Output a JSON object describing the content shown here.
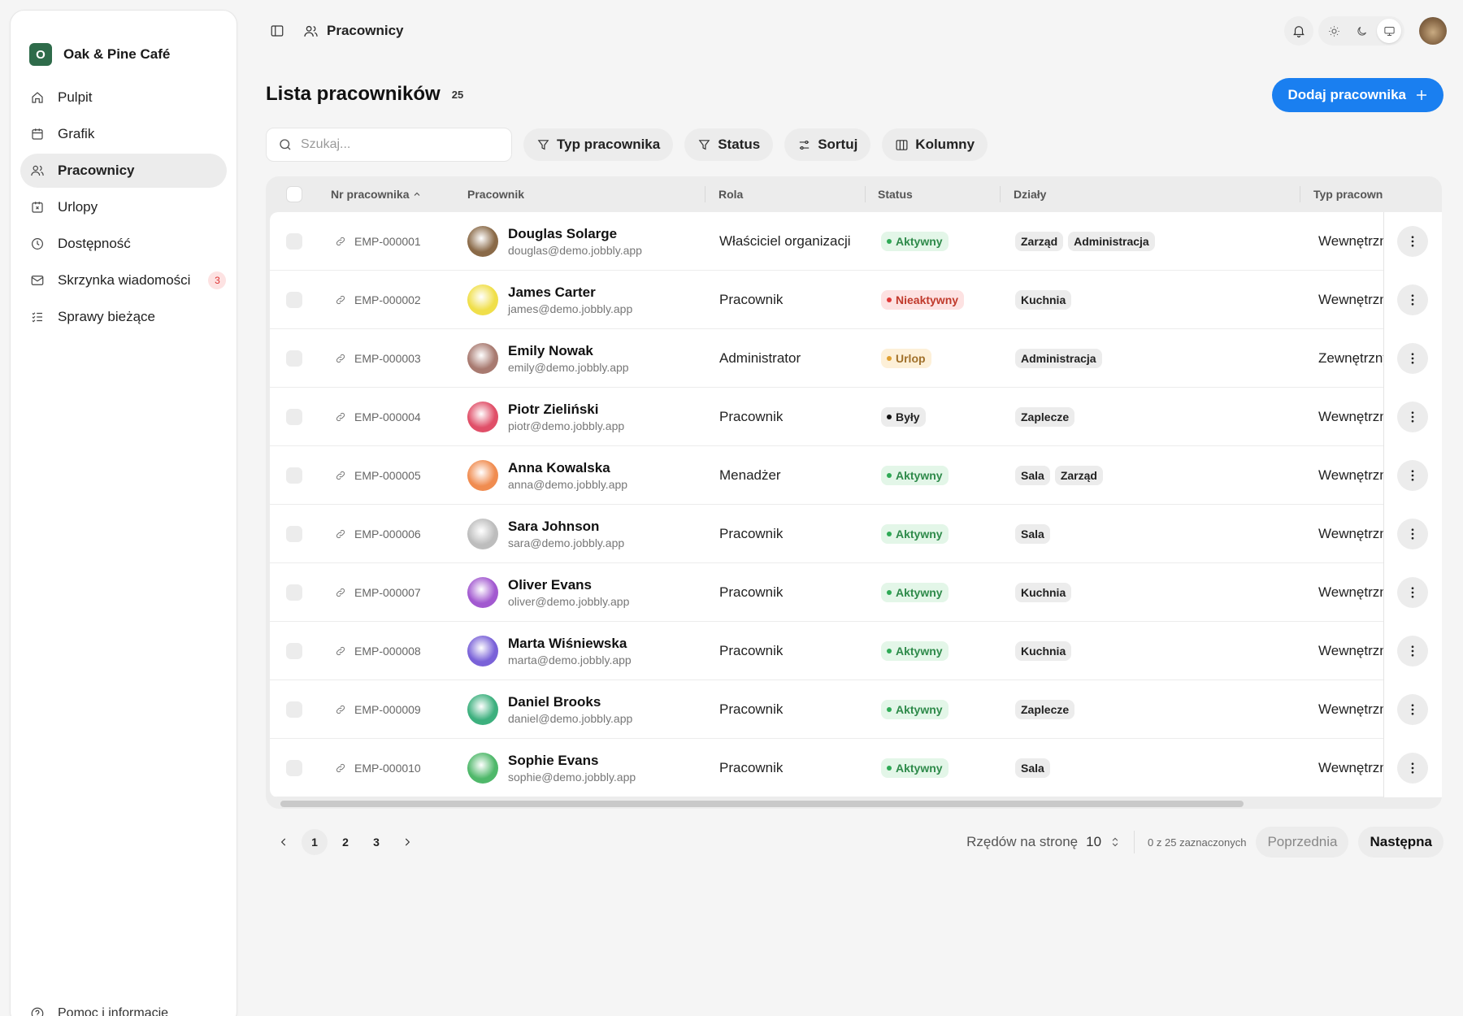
{
  "sidebar": {
    "brand_initial": "O",
    "brand_name": "Oak & Pine Café",
    "items": [
      {
        "label": "Pulpit",
        "icon": "home-icon",
        "badge": ""
      },
      {
        "label": "Grafik",
        "icon": "calendar-icon",
        "badge": ""
      },
      {
        "label": "Pracownicy",
        "icon": "users-icon",
        "badge": "",
        "active": true
      },
      {
        "label": "Urlopy",
        "icon": "calendar-x-icon",
        "badge": ""
      },
      {
        "label": "Dostępność",
        "icon": "clock-icon",
        "badge": ""
      },
      {
        "label": "Skrzynka wiadomości",
        "icon": "mail-icon",
        "badge": "3"
      },
      {
        "label": "Sprawy bieżące",
        "icon": "list-check-icon",
        "badge": ""
      }
    ],
    "help_label": "Pomoc i informacje"
  },
  "topbar": {
    "breadcrumb": "Pracownicy"
  },
  "page": {
    "title": "Lista pracowników",
    "count": "25",
    "add_button": "Dodaj pracownika"
  },
  "toolbar": {
    "search_placeholder": "Szukaj...",
    "filter_type": "Typ pracownika",
    "filter_status": "Status",
    "sort": "Sortuj",
    "columns": "Kolumny"
  },
  "table": {
    "headers": {
      "id": "Nr pracownika",
      "employee": "Pracownik",
      "role": "Rola",
      "status": "Status",
      "departments": "Działy",
      "type": "Typ pracown"
    },
    "rows": [
      {
        "id": "EMP-000001",
        "name": "Douglas Solarge",
        "email": "douglas@demo.jobbly.app",
        "role": "Właściciel organizacji",
        "status": "Aktywny",
        "depts": [
          "Zarząd",
          "Administracja"
        ],
        "type": "Wewnętrzny"
      },
      {
        "id": "EMP-000002",
        "name": "James Carter",
        "email": "james@demo.jobbly.app",
        "role": "Pracownik",
        "status": "Nieaktywny",
        "depts": [
          "Kuchnia"
        ],
        "type": "Wewnętrzny"
      },
      {
        "id": "EMP-000003",
        "name": "Emily Nowak",
        "email": "emily@demo.jobbly.app",
        "role": "Administrator",
        "status": "Urlop",
        "depts": [
          "Administracja"
        ],
        "type": "Zewnętrzny"
      },
      {
        "id": "EMP-000004",
        "name": "Piotr Zieliński",
        "email": "piotr@demo.jobbly.app",
        "role": "Pracownik",
        "status": "Były",
        "depts": [
          "Zaplecze"
        ],
        "type": "Wewnętrzny"
      },
      {
        "id": "EMP-000005",
        "name": "Anna Kowalska",
        "email": "anna@demo.jobbly.app",
        "role": "Menadżer",
        "status": "Aktywny",
        "depts": [
          "Sala",
          "Zarząd"
        ],
        "type": "Wewnętrzny"
      },
      {
        "id": "EMP-000006",
        "name": "Sara Johnson",
        "email": "sara@demo.jobbly.app",
        "role": "Pracownik",
        "status": "Aktywny",
        "depts": [
          "Sala"
        ],
        "type": "Wewnętrzny"
      },
      {
        "id": "EMP-000007",
        "name": "Oliver Evans",
        "email": "oliver@demo.jobbly.app",
        "role": "Pracownik",
        "status": "Aktywny",
        "depts": [
          "Kuchnia"
        ],
        "type": "Wewnętrzny"
      },
      {
        "id": "EMP-000008",
        "name": "Marta Wiśniewska",
        "email": "marta@demo.jobbly.app",
        "role": "Pracownik",
        "status": "Aktywny",
        "depts": [
          "Kuchnia"
        ],
        "type": "Wewnętrzny"
      },
      {
        "id": "EMP-000009",
        "name": "Daniel Brooks",
        "email": "daniel@demo.jobbly.app",
        "role": "Pracownik",
        "status": "Aktywny",
        "depts": [
          "Zaplecze"
        ],
        "type": "Wewnętrzny"
      },
      {
        "id": "EMP-000010",
        "name": "Sophie Evans",
        "email": "sophie@demo.jobbly.app",
        "role": "Pracownik",
        "status": "Aktywny",
        "depts": [
          "Sala"
        ],
        "type": "Wewnętrzny"
      }
    ],
    "avatar_colors": [
      "#8a6a48",
      "#f0df4a",
      "#a87a70",
      "#e04f68",
      "#f08c50",
      "#bdbdbd",
      "#a259d0",
      "#7a62d8",
      "#3db07e",
      "#4fb86a"
    ],
    "status_colors": {
      "Aktywny": {
        "bg": "#e3f6e8",
        "fg": "#2e8a4a",
        "dot": "#2eaa55"
      },
      "Nieaktywny": {
        "bg": "#fde2e2",
        "fg": "#c0392b",
        "dot": "#e03a3a"
      },
      "Urlop": {
        "bg": "#fdf0d8",
        "fg": "#a0702a",
        "dot": "#e0a030"
      },
      "Były": {
        "bg": "#ececec",
        "fg": "#222222",
        "dot": "#111111"
      }
    }
  },
  "pagination": {
    "pages": [
      "1",
      "2",
      "3"
    ],
    "current": "1",
    "rows_per_page_label": "Rzędów na stronę",
    "rows_per_page_value": "10",
    "selected_info": "0 z 25 zaznaczonych",
    "prev_label": "Poprzednia",
    "next_label": "Następna"
  },
  "colors": {
    "accent": "#1a7ff0",
    "brand": "#2e6b4a"
  }
}
